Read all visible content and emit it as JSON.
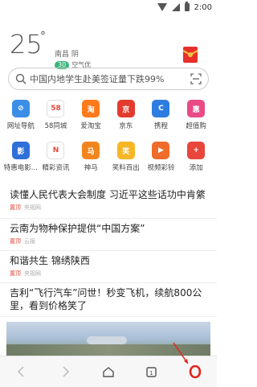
{
  "status": {
    "time": "2:00"
  },
  "weather": {
    "temp": "25",
    "deg": "°",
    "city": "南昌 阴",
    "aqi": "30",
    "aq_label": "空气优"
  },
  "search": {
    "query": "中国内地学生赴美签证量下跌99%",
    "icon": "search-icon",
    "scan_icon": "scan-icon"
  },
  "shortcuts": [
    [
      {
        "label": "网址导航",
        "icon": "compass-icon",
        "color": "#3a8ee6",
        "glyph": "⊘"
      },
      {
        "label": "58同城",
        "icon": "58-icon",
        "color": "#ffffff",
        "glyph": "58"
      },
      {
        "label": "爱淘宝",
        "icon": "taobao-icon",
        "color": "#ff7a1a",
        "glyph": "淘"
      },
      {
        "label": "京东",
        "icon": "jd-icon",
        "color": "#e33b2e",
        "glyph": "京"
      },
      {
        "label": "携程",
        "icon": "ctrip-icon",
        "color": "#2f7de0",
        "glyph": "C"
      },
      {
        "label": "超值购",
        "icon": "deal-icon",
        "color": "#e94b86",
        "glyph": "惠"
      }
    ],
    [
      {
        "label": "特惠电影...",
        "icon": "movie-icon",
        "color": "#2e6fd8",
        "glyph": "影"
      },
      {
        "label": "精彩资讯",
        "icon": "news-icon",
        "color": "#ffffff",
        "glyph": "N"
      },
      {
        "label": "神马",
        "icon": "shenma-icon",
        "color": "#f2851d",
        "glyph": "马"
      },
      {
        "label": "笑料百出",
        "icon": "joke-icon",
        "color": "#f6b626",
        "glyph": "笑"
      },
      {
        "label": "视频彩铃",
        "icon": "video-icon",
        "color": "#f06c2b",
        "glyph": "▶"
      },
      {
        "label": "添加",
        "icon": "add-icon",
        "color": "#e8463b",
        "glyph": "+"
      }
    ]
  ],
  "news": [
    {
      "title": "读懂人民代表大会制度 习近平这些话功中肯綮",
      "tag": "置顶",
      "source": "央视网"
    },
    {
      "title": "云南为物种保护提供“中国方案”",
      "tag": "置顶",
      "source": "云报"
    },
    {
      "title": "和谐共生 锦绣陕西",
      "tag": "置顶",
      "source": "央视网"
    },
    {
      "title": "吉利“飞行汽车”问世！秒变飞机，续航800公里，看到价格笑了",
      "tag": "",
      "source": ""
    }
  ],
  "bottom_nav": [
    {
      "name": "back-button",
      "icon": "chevron-left-icon"
    },
    {
      "name": "forward-button",
      "icon": "chevron-right-icon"
    },
    {
      "name": "home-button",
      "icon": "home-icon"
    },
    {
      "name": "tabs-button",
      "icon": "tabs-icon"
    },
    {
      "name": "opera-menu-button",
      "icon": "opera-icon"
    }
  ],
  "colors": {
    "accent": "#e0483a",
    "aq_green": "#3ab57a"
  }
}
